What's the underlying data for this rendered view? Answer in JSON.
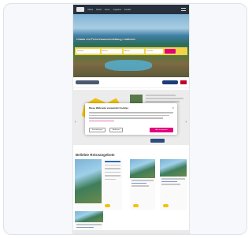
{
  "header": {
    "nav": [
      "Urlaub",
      "Hotels",
      "Ferien",
      "Angebote",
      "Kontakt"
    ]
  },
  "hero": {
    "title": "Urlaub mit Ferienhausvermittlung Lindholm",
    "search_fields": [
      "Reiseziel",
      "Anreise",
      "Abreise",
      "Personen"
    ]
  },
  "dialog": {
    "title": "Diese Webseite verwendet Cookies",
    "close": "×",
    "buttons": {
      "settings": "Einstellungen",
      "decline": "Ablehnen",
      "accept": "Alle akzeptieren"
    }
  },
  "section": {
    "title": "Beliebte Reiseangebote"
  },
  "colors": {
    "accent_pink": "#e3007d",
    "brand_yellow": "#f3d34a",
    "header_dark": "#26313d"
  }
}
